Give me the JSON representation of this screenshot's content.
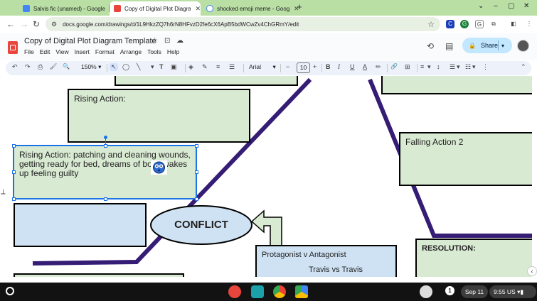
{
  "browser": {
    "tabs": [
      {
        "title": "Salvis fic (unamed) - Google D",
        "favicon_color": "#4285f4",
        "active": false
      },
      {
        "title": "Copy of Digital Plot Diagram T",
        "favicon_color": "#e8453c",
        "active": true
      },
      {
        "title": "shocked emoji meme - Google",
        "favicon_color": "#4285f4",
        "active": false
      }
    ],
    "close_glyph": "✕",
    "new_tab_glyph": "+",
    "url": "docs.google.com/drawings/d/1L9HkzZQ7h6rN8HFvzD2fe6cX6ApB5bdWCwZv4ChGRmY/edit",
    "extension_labels": [
      "C",
      "G",
      "G",
      "Z",
      "P",
      "G"
    ],
    "nav_glyphs": {
      "back": "←",
      "forward": "→",
      "reload": "↻"
    },
    "window_glyphs": [
      "⌄",
      "–",
      "▢",
      "✕"
    ]
  },
  "doc": {
    "title": "Copy of Digital Plot Diagram Template",
    "menu": [
      "File",
      "Edit",
      "View",
      "Insert",
      "Format",
      "Arrange",
      "Tools",
      "Help"
    ],
    "share_label": "Share",
    "zoom": "150%",
    "font": "Arial",
    "font_size": "10"
  },
  "toolbar_icons": [
    "undo-icon",
    "redo-icon",
    "print-icon",
    "paint-format-icon",
    "zoom-icon",
    "select-icon",
    "shape-icon",
    "line-icon",
    "text-box-icon",
    "image-icon",
    "fill-color-icon",
    "border-color-icon",
    "border-weight-icon",
    "border-dash-icon",
    "bold-icon",
    "italic-icon",
    "underline-icon",
    "text-color-icon",
    "highlight-icon",
    "link-icon",
    "comment-icon",
    "align-icon",
    "line-spacing-icon",
    "bulleted-list-icon",
    "numbered-list-icon",
    "more-icon"
  ],
  "toolbar_glyphs": {
    "undo": "↶",
    "redo": "↷",
    "print": "⎙",
    "paint_format": "🖌",
    "zoom": "🔍",
    "select": "↖",
    "shape": "◯",
    "line": "╲",
    "text_box": "T",
    "image": "▣",
    "fill": "◈",
    "border_color": "✎",
    "border_weight": "≡",
    "border_dash": "☰",
    "minus": "−",
    "plus": "+",
    "bold": "B",
    "italic": "I",
    "underline": "U",
    "text_color": "A",
    "highlight": "✏",
    "link": "🔗",
    "comment": "⊞",
    "align": "≡",
    "line_spacing": "↕",
    "bulleted_list": "☰",
    "numbered_list": "☷",
    "more": "⋮",
    "collapse": "⌃",
    "dropdown": "▾"
  },
  "canvas": {
    "rising_action_empty": "Rising Action:",
    "rising_action_selected": "Rising Action: patching and cleaning wounds, getting ready for bed, dreams of boys wakes up feeling guilty",
    "falling_action": "Falling Action 2",
    "conflict": "CONFLICT",
    "protagonist": "Protagonist v  Antagonist",
    "protagonist_sub": "Travis  vs  Travis",
    "resolution": "RESOLUTION:"
  },
  "shelf": {
    "date": "Sep 11",
    "time": "9:55",
    "locale": "US",
    "info": "1"
  },
  "colors": {
    "tabstrip": "#b9dfa4",
    "box_green": "#d9ead3",
    "box_blue": "#cfe2f3",
    "diagram_line": "#351c75",
    "selection": "#1a73e8",
    "share_button": "#c2e7ff"
  }
}
